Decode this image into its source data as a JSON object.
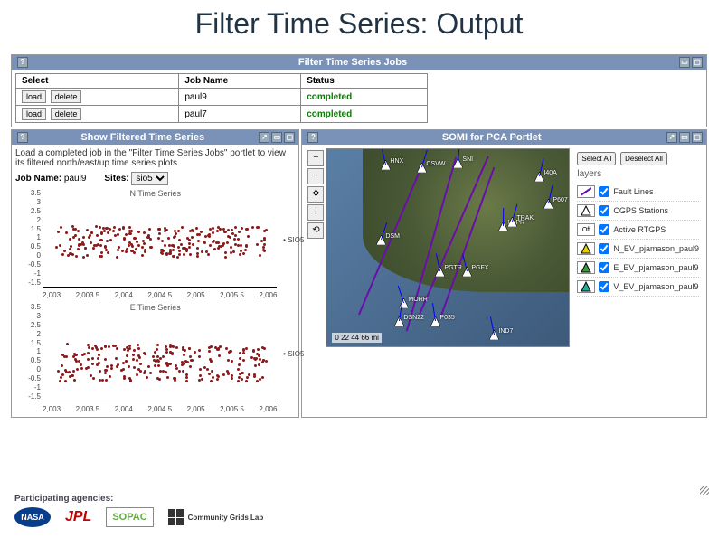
{
  "title": "Filter Time Series: Output",
  "jobs_portlet": {
    "title": "Filter Time Series Jobs",
    "help": "?",
    "cols": {
      "select": "Select",
      "jobname": "Job Name",
      "status": "Status"
    },
    "rows": [
      {
        "load": "load",
        "del": "delete",
        "name": "paul9",
        "status": "completed"
      },
      {
        "load": "load",
        "del": "delete",
        "name": "paul7",
        "status": "completed"
      }
    ]
  },
  "ts_portlet": {
    "title": "Show Filtered Time Series",
    "help": "?",
    "instr": "Load a completed job in the \"Filter Time Series Jobs\" portlet to view its filtered north/east/up time series plots",
    "jobname_label": "Job Name:",
    "jobname_value": "paul9",
    "sites_label": "Sites:",
    "site_selected": "sio5"
  },
  "chart_data": [
    {
      "type": "scatter",
      "title": "N Time Series",
      "xlabel": "",
      "ylabel": "",
      "ylim": [
        -1.5,
        3.5
      ],
      "ytick": [
        3.5,
        3,
        2.5,
        2,
        1.5,
        1,
        0.5,
        0,
        -0.5,
        -1,
        -1.5
      ],
      "xtick": [
        "2,003",
        "2,003.5",
        "2,004",
        "2,004.5",
        "2,005",
        "2,005.5",
        "2,006"
      ],
      "series": [
        {
          "name": "SIO5",
          "band_center": 1.2,
          "band_spread": 0.9
        }
      ]
    },
    {
      "type": "scatter",
      "title": "E Time Series",
      "xlabel": "",
      "ylabel": "",
      "ylim": [
        -1.5,
        3.5
      ],
      "ytick": [
        3.5,
        3,
        2.5,
        2,
        1.5,
        1,
        0.5,
        0,
        -0.5,
        -1,
        -1.5
      ],
      "xtick": [
        "2,003",
        "2,003.5",
        "2,004",
        "2,004.5",
        "2,005",
        "2,005.5",
        "2,006"
      ],
      "series": [
        {
          "name": "SIO5",
          "band_center": 0.8,
          "band_spread": 1.1
        }
      ]
    }
  ],
  "map_portlet": {
    "title": "SOMI for PCA Portlet",
    "help": "?",
    "tools": {
      "zoom_in": "+",
      "zoom_out": "−",
      "pan": "✥",
      "info": "i",
      "reset": "⟲"
    },
    "stations": [
      "HNX",
      "CSVW",
      "SNI",
      "I40A",
      "P607",
      "HLPR",
      "TRAK",
      "DSM",
      "PGTR",
      "PGFX",
      "MORR",
      "DSN22",
      "P035",
      "IND7"
    ],
    "scale": {
      "ticks": [
        "0",
        "22",
        "44",
        "66"
      ],
      "unit": "mi"
    },
    "layers_title": "layers",
    "select_all": "Select All",
    "deselect_all": "Deselect All",
    "layers": [
      {
        "name": "Fault Lines",
        "checked": true,
        "swatch": "line-purple"
      },
      {
        "name": "CGPS Stations",
        "checked": true,
        "swatch": "tri-white"
      },
      {
        "name": "Active RTGPS",
        "checked": true,
        "swatch": "off"
      },
      {
        "name": "N_EV_pjamason_paul9",
        "checked": true,
        "swatch": "tri-yellow"
      },
      {
        "name": "E_EV_pjamason_paul9",
        "checked": true,
        "swatch": "tri-green"
      },
      {
        "name": "V_EV_pjamason_paul9",
        "checked": true,
        "swatch": "tri-teal"
      }
    ]
  },
  "agencies": {
    "label": "Participating agencies:",
    "list": [
      "NASA",
      "JPL",
      "SOPAC",
      "Community Grids Lab"
    ]
  }
}
